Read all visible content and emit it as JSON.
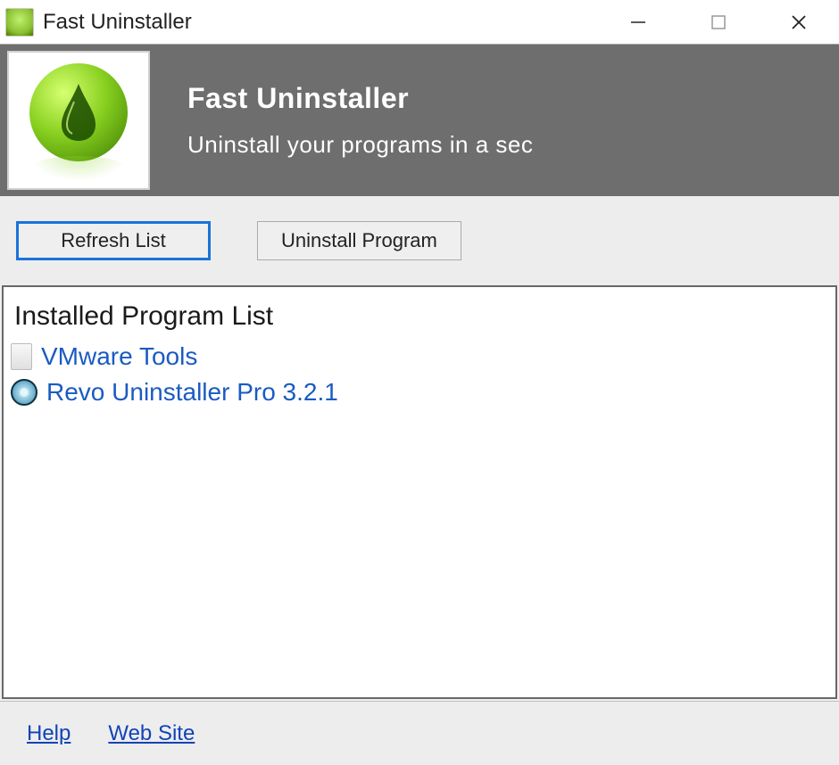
{
  "window": {
    "title": "Fast Uninstaller"
  },
  "header": {
    "title": "Fast Uninstaller",
    "subtitle": "Uninstall your programs in a sec"
  },
  "toolbar": {
    "refresh_label": "Refresh List",
    "uninstall_label": "Uninstall Program"
  },
  "list": {
    "heading": "Installed Program List",
    "items": [
      {
        "name": "VMware Tools",
        "icon": "document-icon"
      },
      {
        "name": "Revo Uninstaller Pro 3.2.1",
        "icon": "revo-icon"
      }
    ]
  },
  "footer": {
    "help": "Help",
    "website": "Web Site"
  }
}
